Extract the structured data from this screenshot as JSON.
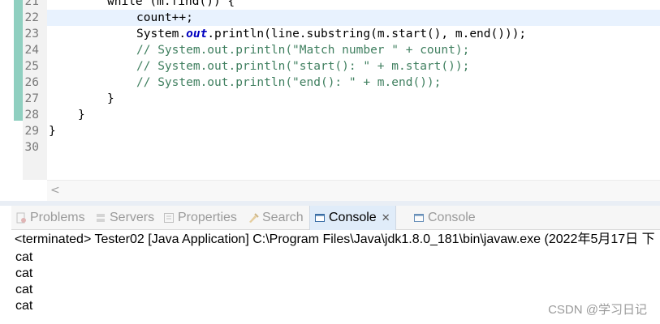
{
  "editor": {
    "lines": [
      {
        "num": "21",
        "indent": 72,
        "tokens": [
          {
            "type": "plain",
            "text": "while (m.find()) {"
          }
        ]
      },
      {
        "num": "22",
        "indent": 108,
        "current": true,
        "tokens": [
          {
            "type": "plain",
            "text": "count++;"
          }
        ]
      },
      {
        "num": "23",
        "indent": 108,
        "tokens": [
          {
            "type": "plain",
            "text": "System."
          },
          {
            "type": "field",
            "text": "out"
          },
          {
            "type": "plain",
            "text": ".println(line.substring(m.start(), m.end()));"
          }
        ]
      },
      {
        "num": "24",
        "indent": 108,
        "tokens": [
          {
            "type": "comment",
            "text": "// System.out.println(\"Match number \" + count);"
          }
        ]
      },
      {
        "num": "25",
        "indent": 108,
        "tokens": [
          {
            "type": "comment",
            "text": "// System.out.println(\"start(): \" + m.start());"
          }
        ]
      },
      {
        "num": "26",
        "indent": 108,
        "tokens": [
          {
            "type": "comment",
            "text": "// System.out.println(\"end(): \" + m.end());"
          }
        ]
      },
      {
        "num": "27",
        "indent": 72,
        "tokens": [
          {
            "type": "plain",
            "text": "}"
          }
        ]
      },
      {
        "num": "28",
        "indent": 36,
        "tokens": [
          {
            "type": "plain",
            "text": "}"
          }
        ]
      },
      {
        "num": "29",
        "indent": 0,
        "tokens": [
          {
            "type": "plain",
            "text": "}"
          }
        ]
      },
      {
        "num": "30",
        "indent": 0,
        "tokens": []
      }
    ],
    "scroll_left_glyph": "<"
  },
  "tabs": [
    {
      "name": "tab-problems",
      "label": "Problems",
      "icon": "problems-icon"
    },
    {
      "name": "tab-servers",
      "label": "Servers",
      "icon": "servers-icon"
    },
    {
      "name": "tab-properties",
      "label": "Properties",
      "icon": "properties-icon"
    },
    {
      "name": "tab-search",
      "label": "Search",
      "icon": "search-icon"
    },
    {
      "name": "tab-console-active",
      "label": "Console",
      "icon": "console-icon",
      "active": true,
      "close": "✕"
    },
    {
      "name": "tab-console",
      "label": "Console",
      "icon": "console-icon"
    }
  ],
  "console": {
    "header": "<terminated> Tester02 [Java Application] C:\\Program Files\\Java\\jdk1.8.0_181\\bin\\javaw.exe (2022年5月17日 下",
    "output": [
      "cat",
      "cat",
      "cat",
      "cat"
    ]
  },
  "watermark": "CSDN @学习日记",
  "colors": {
    "comment": "#3f7f5f",
    "field": "#0000c0",
    "current_line": "#e8f2fe",
    "change_bar": "#8fcfc0",
    "active_tab": "#e0ecf9"
  }
}
